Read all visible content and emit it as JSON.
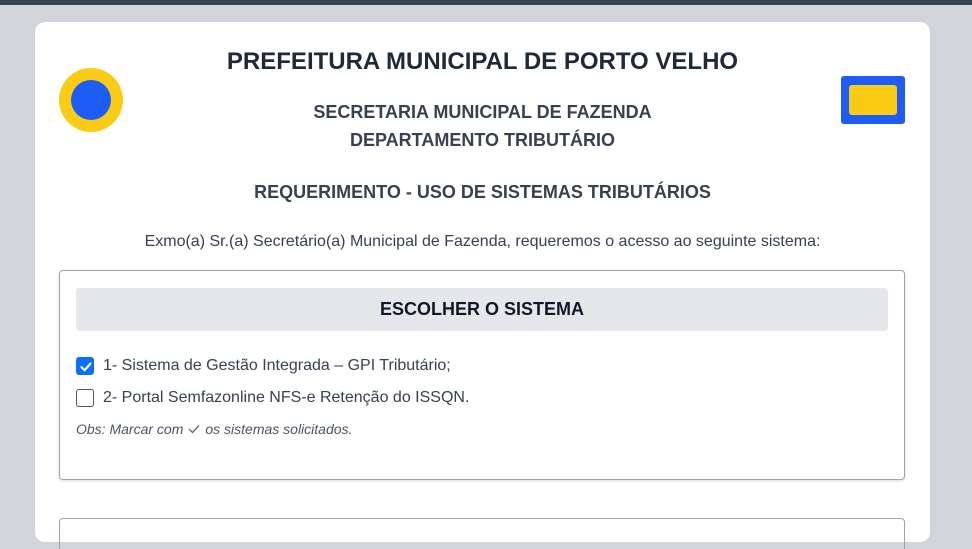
{
  "header": {
    "title": "PREFEITURA MUNICIPAL DE PORTO VELHO",
    "secretaria": "SECRETARIA MUNICIPAL DE FAZENDA",
    "departamento": "DEPARTAMENTO TRIBUTÁRIO",
    "request_title": "REQUERIMENTO - USO DE SISTEMAS TRIBUTÁRIOS",
    "intro_text": "Exmo(a) Sr.(a) Secretário(a) Municipal de Fazenda, requeremos o acesso ao seguinte sistema:"
  },
  "system_choice": {
    "heading": "ESCOLHER O SISTEMA",
    "options": [
      {
        "label": "1- Sistema de Gestão Integrada – GPI Tributário;",
        "checked": true
      },
      {
        "label": "2- Portal Semfazonline NFS-e Retenção do ISSQN.",
        "checked": false
      }
    ],
    "obs_prefix": "Obs: Marcar com",
    "obs_suffix": "os sistemas solicitados."
  },
  "icons": {
    "left_logo": "municipal-seal-icon",
    "right_logo": "flag-icon",
    "check": "check-icon"
  },
  "colors": {
    "primary_blue": "#1d5cf5",
    "accent_yellow": "#facc15",
    "checkbox_blue": "#0d6efd"
  }
}
